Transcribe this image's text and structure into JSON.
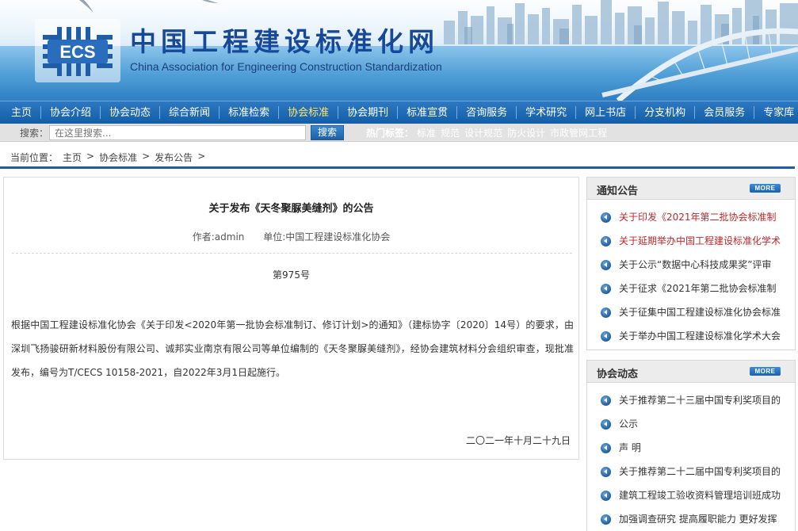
{
  "header": {
    "logo_text": "ECS",
    "title": "中国工程建设标准化网",
    "subtitle": "China Association for Engineering Construction Standardization"
  },
  "nav": {
    "items": [
      "主页",
      "协会介绍",
      "协会动态",
      "综合新闻",
      "标准检索",
      "协会标准",
      "协会期刊",
      "标准宣贯",
      "咨询服务",
      "学术研究",
      "网上书店",
      "分支机构",
      "会员服务",
      "专家库"
    ],
    "active_index": 5
  },
  "search": {
    "label": "搜索：",
    "placeholder": "在这里搜索...",
    "button": "搜索",
    "hot_label": "热门标签：",
    "tags": [
      "标准",
      "规范",
      "设计规范",
      "防火设计",
      "市政管网工程"
    ]
  },
  "breadcrumb": {
    "prefix": "当前位置：",
    "items": [
      "主页",
      "协会标准",
      "发布公告"
    ],
    "separator": ">"
  },
  "article": {
    "title": "关于发布《天冬聚脲美缝剂》的公告",
    "author": "作者:admin",
    "unit": "单位:中国工程建设标准化协会",
    "number": "第975号",
    "body": "根据中国工程建设标准化协会《关于印发<2020年第一批协会标准制订、修订计划>的通知》（建标协字〔2020〕14号）的要求，由深圳飞扬骏研新材料股份有限公司、诚邦实业南京有限公司等单位编制的《天冬聚脲美缝剂》，经协会建筑材料分会组织审查，现批准发布，编号为T/CECS 10158-2021，自2022年3月1日起施行。",
    "date": "二〇二一年十月二十九日"
  },
  "sidebar": {
    "notices": {
      "title": "通知公告",
      "more": "MORE",
      "items": [
        {
          "text": "关于印发《2021年第二批协会标准制",
          "highlight": true
        },
        {
          "text": "关于延期举办中国工程建设标准化学术",
          "highlight": true
        },
        {
          "text": "关于公示“数据中心科技成果奖”评审",
          "highlight": false
        },
        {
          "text": "关于征求《2021年第二批协会标准制",
          "highlight": false
        },
        {
          "text": "关于征集中国工程建设标准化协会标准",
          "highlight": false
        },
        {
          "text": "关于举办中国工程建设标准化学术大会",
          "highlight": false
        }
      ]
    },
    "news": {
      "title": "协会动态",
      "more": "MORE",
      "items": [
        {
          "text": "关于推荐第二十三届中国专利奖项目的"
        },
        {
          "text": "公示"
        },
        {
          "text": "声 明"
        },
        {
          "text": "关于推荐第二十二届中国专利奖项目的"
        },
        {
          "text": "建筑工程竣工验收资料管理培训班成功"
        },
        {
          "text": "加强调查研究 提高履职能力 更好发挥"
        }
      ]
    }
  },
  "colors": {
    "nav_bg": "#1a64ad",
    "nav_active": "#ffe66a",
    "title_blue": "#17489a",
    "highlight_red": "#c0282a"
  }
}
